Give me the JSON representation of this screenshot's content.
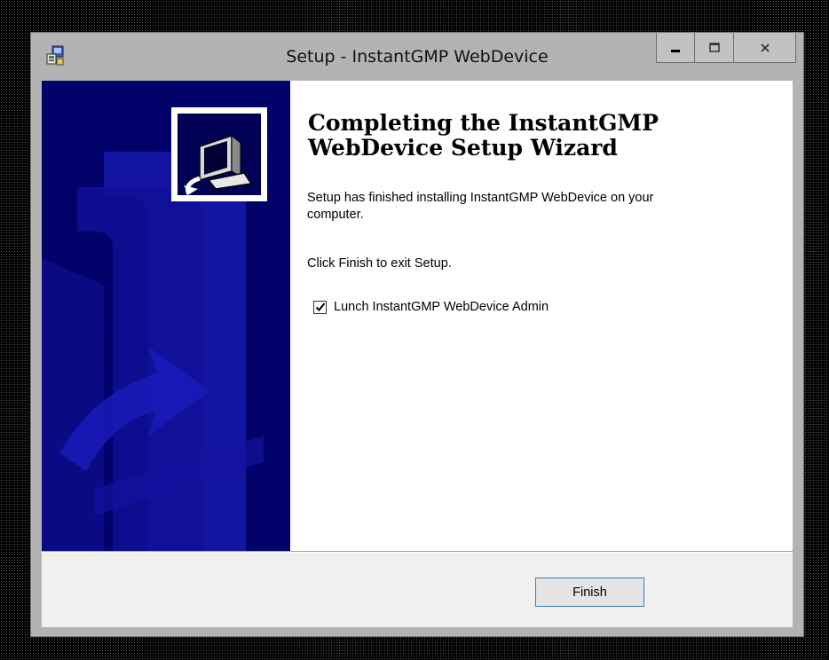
{
  "window": {
    "title": "Setup - InstantGMP WebDevice",
    "controls": {
      "minimize": "minimize-icon",
      "maximize": "maximize-icon",
      "close": "close-icon"
    }
  },
  "wizard": {
    "heading_line1": "Completing the InstantGMP",
    "heading_line2": "WebDevice Setup Wizard",
    "message_line1": "Setup has finished installing InstantGMP WebDevice on your",
    "message_line2": "computer.",
    "exit_hint": "Click Finish to exit Setup.",
    "launch_option": {
      "label": "Lunch InstantGMP WebDevice Admin",
      "checked": true
    }
  },
  "footer": {
    "finish_label": "Finish"
  },
  "colors": {
    "banner_dark": "#000066",
    "banner_shape": "#1a1ab8",
    "accent_border": "#3c7fb1"
  }
}
